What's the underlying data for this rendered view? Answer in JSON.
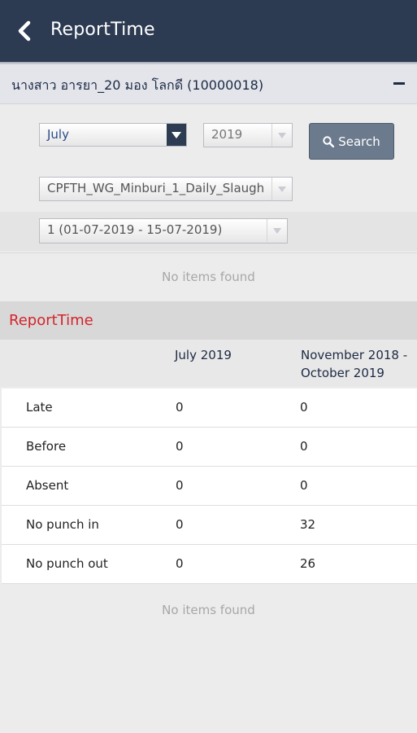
{
  "app": {
    "title": "ReportTime"
  },
  "employee": {
    "name": "นางสาว อารยา_20 มอง โลกดี (10000018)"
  },
  "filters": {
    "month": "July",
    "year": "2019",
    "search_label": "Search",
    "group": "CPFTH_WG_Minburi_1_Daily_Slaugh",
    "period": "1 (01-07-2019 - 15-07-2019)"
  },
  "messages": {
    "empty_top": "No items found",
    "empty_bottom": "No items found"
  },
  "report": {
    "title": "ReportTime",
    "columns": [
      "July 2019",
      "November 2018 - October 2019"
    ],
    "rows": [
      {
        "label": "Late",
        "month": "0",
        "year": "0"
      },
      {
        "label": "Before",
        "month": "0",
        "year": "0"
      },
      {
        "label": "Absent",
        "month": "0",
        "year": "0"
      },
      {
        "label": "No punch in",
        "month": "0",
        "year": "32"
      },
      {
        "label": "No punch out",
        "month": "0",
        "year": "26"
      }
    ]
  },
  "colors": {
    "header": "#2d3b52",
    "accent_red": "#d3242b",
    "button": "#6b7a8d"
  }
}
